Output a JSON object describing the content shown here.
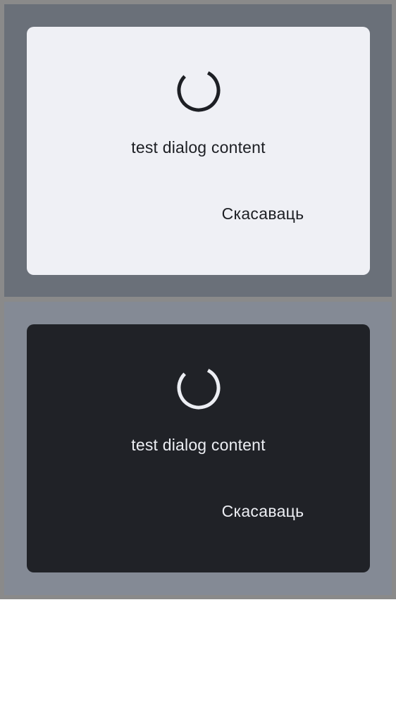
{
  "variants": [
    {
      "theme": "light",
      "dialog": {
        "content_text": "test dialog content",
        "cancel_label": "Скасаваць"
      },
      "colors": {
        "scrim": "#6a7079",
        "surface": "#eff0f5",
        "on_surface": "#1d1f24"
      },
      "spinner_icon": "progress-spinner-icon"
    },
    {
      "theme": "dark",
      "dialog": {
        "content_text": "test dialog content",
        "cancel_label": "Скасаваць"
      },
      "colors": {
        "scrim": "#848a95",
        "surface": "#202227",
        "on_surface": "#eceef3"
      },
      "spinner_icon": "progress-spinner-icon"
    }
  ]
}
